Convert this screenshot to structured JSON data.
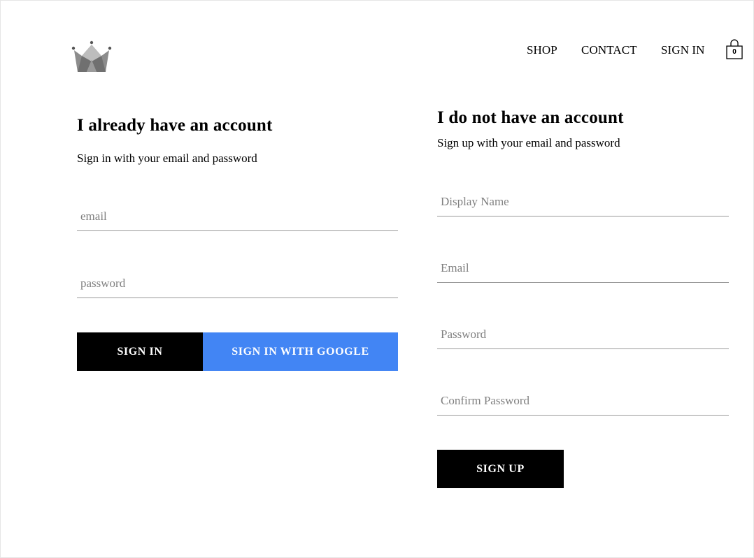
{
  "header": {
    "logo_icon": "crown-icon",
    "nav": {
      "shop": "SHOP",
      "contact": "CONTACT",
      "sign_in": "SIGN IN"
    },
    "cart": {
      "icon": "shopping-bag-icon",
      "count": "0"
    }
  },
  "sign_in": {
    "title": "I already have an account",
    "subtitle": "Sign in with your email and password",
    "email_placeholder": "email",
    "email_value": "",
    "password_placeholder": "password",
    "password_value": "",
    "sign_in_button": "SIGN IN",
    "google_button": "SIGN IN WITH GOOGLE"
  },
  "sign_up": {
    "title": "I do not have an account",
    "subtitle": "Sign up with your email and password",
    "display_name_placeholder": "Display Name",
    "display_name_value": "",
    "email_placeholder": "Email",
    "email_value": "",
    "password_placeholder": "Password",
    "password_value": "",
    "confirm_password_placeholder": "Confirm Password",
    "confirm_password_value": "",
    "sign_up_button": "SIGN UP"
  },
  "colors": {
    "google_blue": "#4285f4",
    "button_black": "#000000",
    "underline_gray": "#9a9a9a",
    "logo_gray": "#808080"
  }
}
